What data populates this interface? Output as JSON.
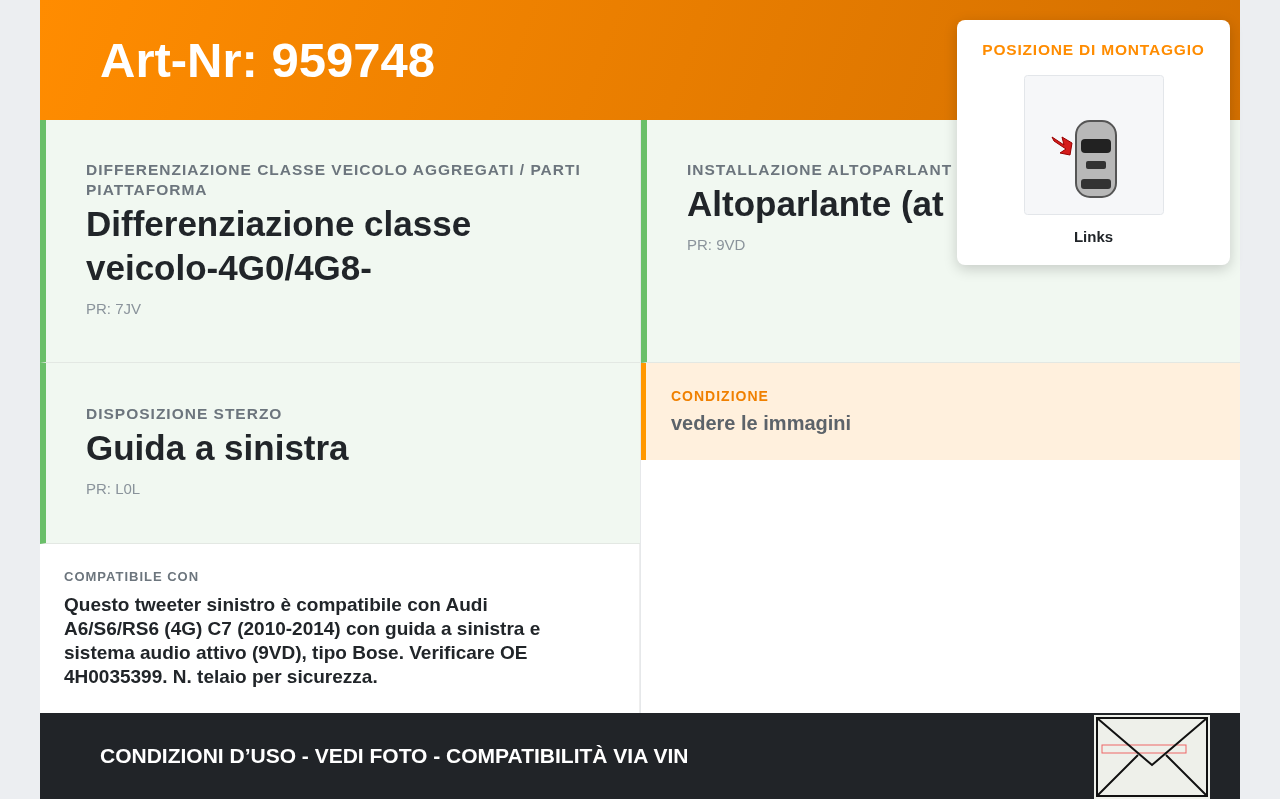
{
  "header": {
    "title": "Art-Nr: 959748"
  },
  "mounting": {
    "title": "POSIZIONE DI MONTAGGIO",
    "caption": "Links"
  },
  "left_cards": [
    {
      "label": "DIFFERENZIAZIONE CLASSE VEICOLO AGGREGATI / PARTI PIATTAFORMA",
      "value": "Differenziazione classe veicolo-4G0/4G8-",
      "code": "PR: 7JV"
    },
    {
      "label": "DISPOSIZIONE STERZO",
      "value": "Guida a sinistra",
      "code": "PR: L0L"
    }
  ],
  "compatibility": {
    "label": "COMPATIBILE CON",
    "text": "Questo tweeter sinistro è compatibile con Audi A6/S6/RS6 (4G) C7 (2010-2014) con guida a sinistra e sistema audio attivo (9VD), tipo Bose. Verificare OE 4H0035399. N. telaio per sicurezza."
  },
  "right_cards": [
    {
      "label": "INSTALLAZIONE ALTOPARLANT",
      "value": "Altoparlante (at",
      "code": "PR: 9VD"
    }
  ],
  "condition": {
    "label": "CONDIZIONE",
    "text": "vedere le immagini"
  },
  "footer": {
    "text": "CONDIZIONI D’USO - VEDI FOTO - COMPATIBILITÀ VIA VIN"
  }
}
